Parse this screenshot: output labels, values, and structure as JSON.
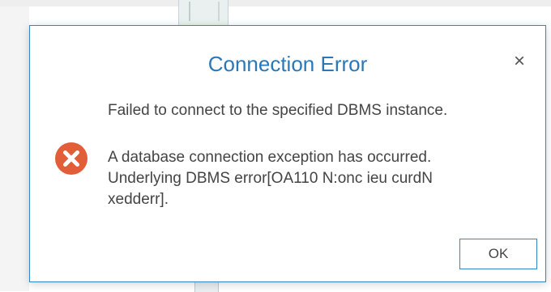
{
  "dialog": {
    "title": "Connection Error",
    "close_icon": "close-icon",
    "message_primary": "Failed to connect to the specified DBMS instance.",
    "message_detail_line1": "A database connection exception has occurred.",
    "message_detail_line2": "Underlying DBMS error[OA110 N:onc ieu curdN",
    "message_detail_line3": "xedderr].",
    "error_icon": "error-icon",
    "ok_label": "OK",
    "close_glyph": "×"
  },
  "colors": {
    "title": "#2a78b8",
    "border_accent": "#2f86c9",
    "error_icon": "#e25e39",
    "text": "#444444"
  }
}
